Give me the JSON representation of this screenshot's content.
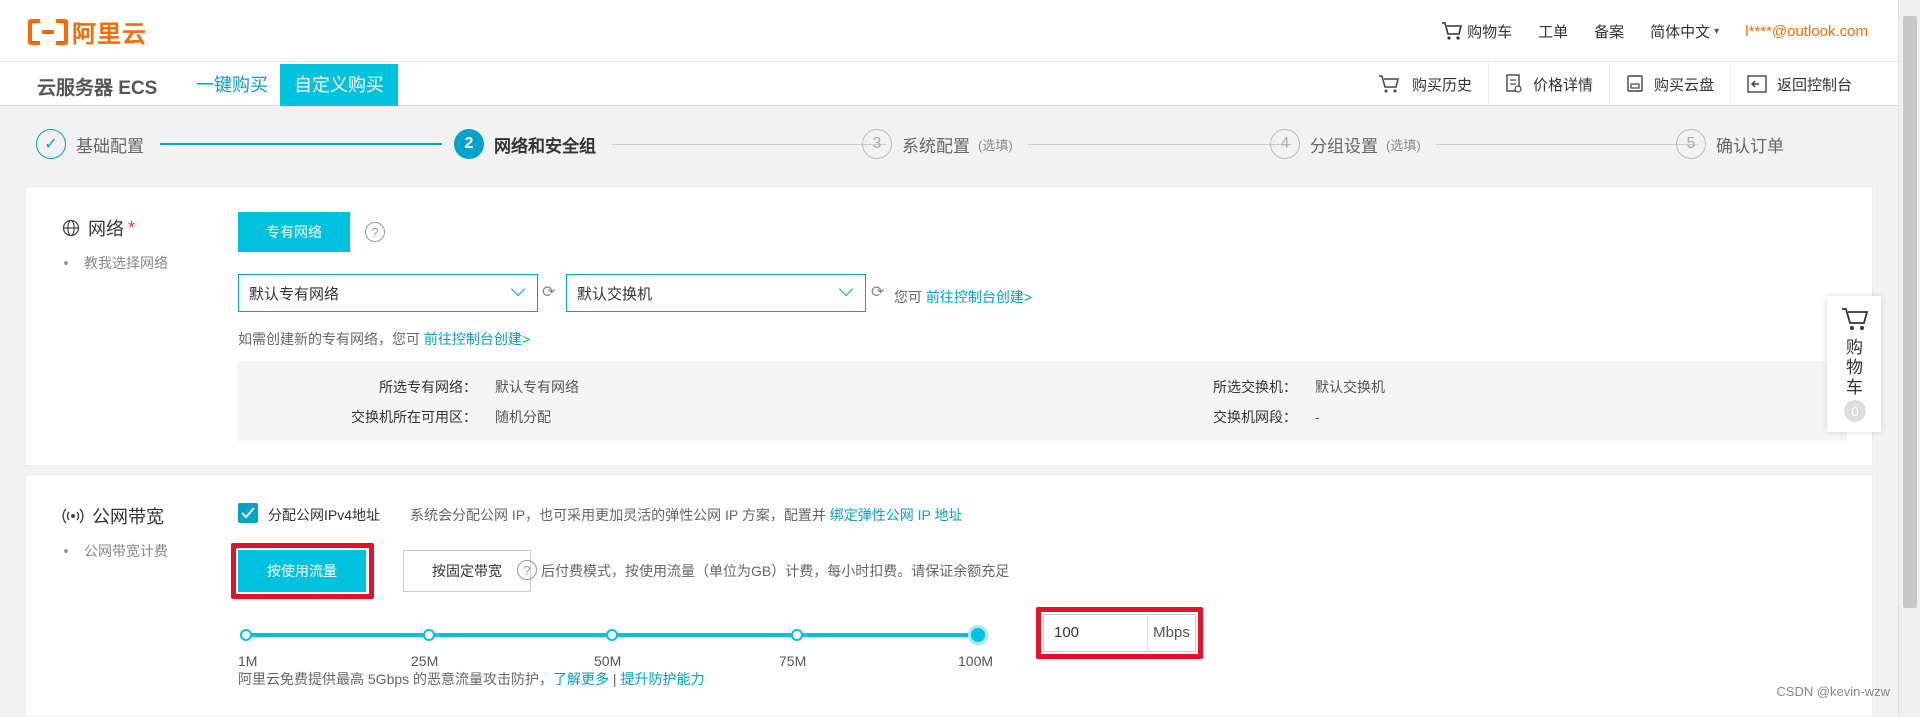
{
  "header": {
    "brand": "阿里云",
    "cart": "购物车",
    "ticket": "工单",
    "beian": "备案",
    "language": "简体中文",
    "account": "l****@outlook.com"
  },
  "subbar": {
    "product": "云服务器 ECS",
    "tab_quick": "一键购买",
    "tab_custom": "自定义购买",
    "links": {
      "history": "购买历史",
      "price": "价格详情",
      "disk": "购买云盘",
      "console": "返回控制台"
    }
  },
  "steps": [
    {
      "num": "✓",
      "label": "基础配置",
      "optional": ""
    },
    {
      "num": "2",
      "label": "网络和安全组",
      "optional": ""
    },
    {
      "num": "3",
      "label": "系统配置",
      "optional": "(选填)"
    },
    {
      "num": "4",
      "label": "分组设置",
      "optional": "(选填)"
    },
    {
      "num": "5",
      "label": "确认订单",
      "optional": ""
    }
  ],
  "network": {
    "title": "网络",
    "required": "*",
    "help": "教我选择网络",
    "type_button": "专有网络",
    "vpc_select": "默认专有网络",
    "vswitch_select": "默认交换机",
    "you_can": "您可",
    "goto_console": "前往控制台创建>",
    "hint_prefix": "如需创建新的专有网络，您可",
    "hint_link": "前往控制台创建>",
    "info": {
      "vpc_key": "所选专有网络：",
      "vpc_val": "默认专有网络",
      "zone_key": "交换机所在可用区：",
      "zone_val": "随机分配",
      "vsw_key": "所选交换机：",
      "vsw_val": "默认交换机",
      "cidr_key": "交换机网段：",
      "cidr_val": "-"
    }
  },
  "bandwidth": {
    "title": "公网带宽",
    "help": "公网带宽计费",
    "assign_ipv4": "分配公网IPv4地址",
    "assign_desc": "系统会分配公网 IP，也可采用更加灵活的弹性公网 IP 方案，配置并",
    "assign_link": "绑定弹性公网 IP 地址",
    "by_traffic": "按使用流量",
    "by_fixed": "按固定带宽",
    "billing_desc": "后付费模式，按使用流量（单位为GB）计费，每小时扣费。请保证余额充足",
    "ticks": [
      "1M",
      "25M",
      "50M",
      "75M",
      "100M"
    ],
    "value": "100",
    "unit": "Mbps",
    "ddos_text": "阿里云免费提供最高 5Gbps 的恶意流量攻击防护，",
    "learn_more": "了解更多",
    "divider": "|",
    "upgrade": "提升防护能力"
  },
  "float_cart": {
    "label": "购物车",
    "count": "0"
  },
  "watermark": "CSDN @kevin-wzw"
}
